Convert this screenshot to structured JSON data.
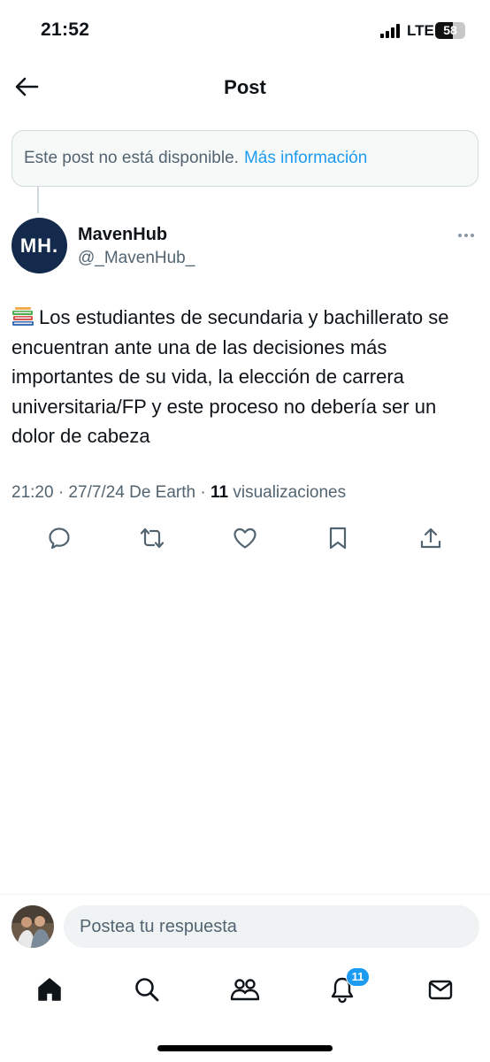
{
  "status_bar": {
    "time": "21:52",
    "network": "LTE",
    "battery": "58",
    "battery_level": 0.58
  },
  "header": {
    "title": "Post"
  },
  "unavailable": {
    "text": "Este post no está disponible.",
    "link": "Más información"
  },
  "post": {
    "avatar_text": "MH.",
    "author_name": "MavenHub",
    "author_handle": "@_MavenHub_",
    "body_icon": "books-emoji",
    "body": "Los estudiantes de secundaria y bachillerato se encuentran ante una de las decisiones más importantes de su vida, la elección de carrera universitaria/FP y este proceso no debería ser un dolor de cabeza",
    "meta_prefix": "21:20 · 27/7/24 De Earth · ",
    "views_count": "11",
    "views_label": " visualizaciones",
    "actions": [
      "reply-icon",
      "repost-icon",
      "like-icon",
      "bookmark-icon",
      "share-icon"
    ]
  },
  "reply": {
    "placeholder": "Postea tu respuesta"
  },
  "bottom_nav": {
    "items": [
      "home-icon",
      "search-icon",
      "communities-icon",
      "notifications-icon",
      "messages-icon"
    ],
    "notifications_badge": "11"
  },
  "colors": {
    "accent": "#1d9bf0",
    "text": "#0f1419",
    "secondary": "#536471",
    "avatar_bg": "#142a4c"
  }
}
